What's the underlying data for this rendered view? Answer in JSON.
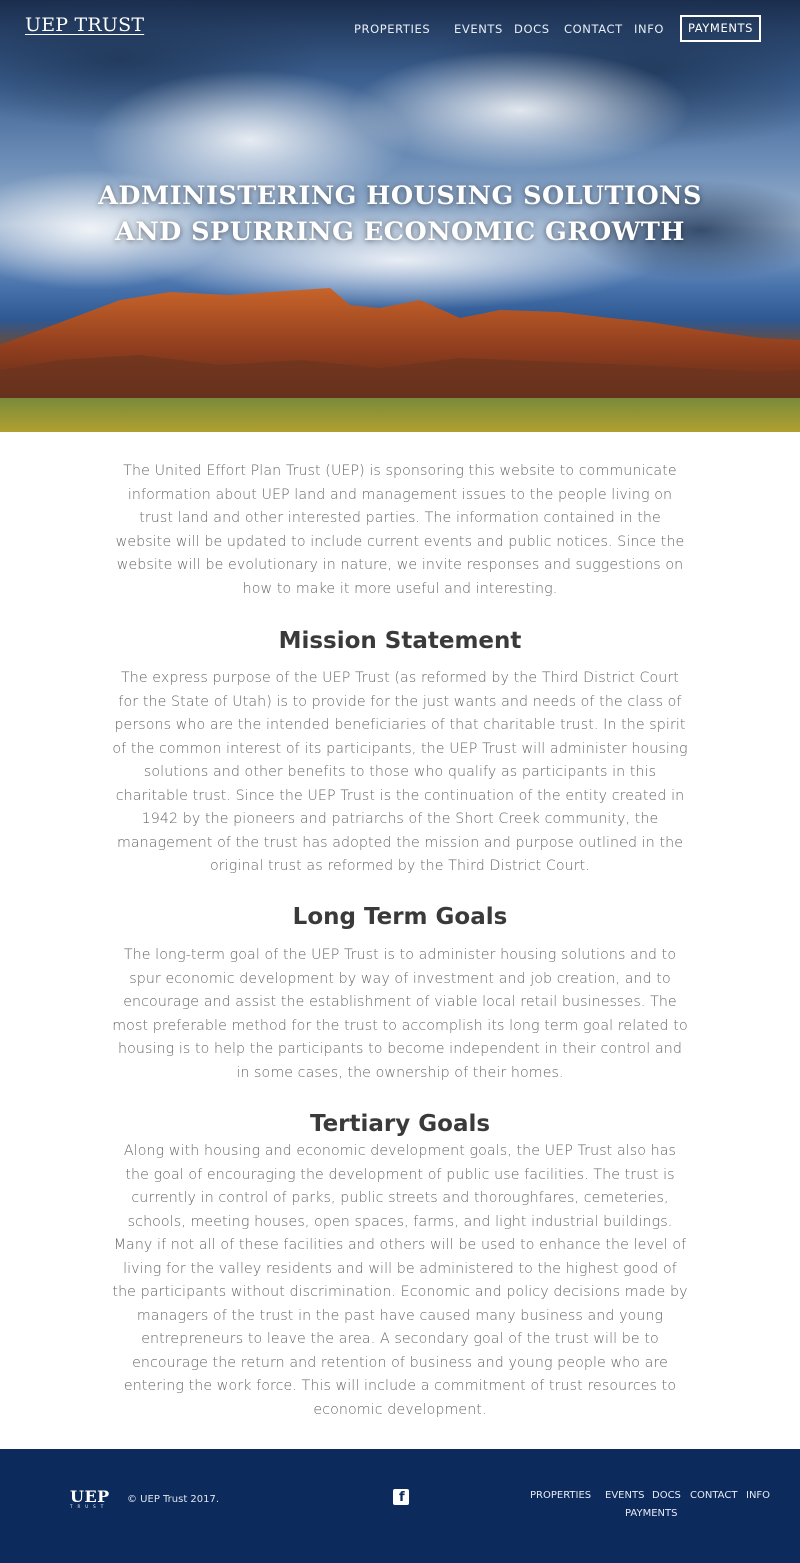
{
  "header": {
    "brand": "UEP TRUST",
    "nav": [
      "PROPERTIES",
      "EVENTS",
      "DOCS",
      "CONTACT",
      "INFO"
    ],
    "payments_button": "PAYMENTS"
  },
  "hero": {
    "title_line1": "ADMINISTERING HOUSING SOLUTIONS",
    "title_line2": "AND SPURRING ECONOMIC GROWTH"
  },
  "main": {
    "intro": "The United Effort Plan Trust (UEP) is sponsoring this website to communicate information about UEP land and management issues to the people living on trust land and other interested parties. The information contained in the website will be updated to include current events and public notices. Since the website will be evolutionary in nature, we invite responses and suggestions on how to make it more useful and interesting.",
    "sections": [
      {
        "heading": "Mission Statement",
        "body": "The express purpose of the UEP Trust (as reformed by the Third District Court for the State of Utah) is to provide for the just wants and needs of the class of persons who are the intended beneficiaries of that charitable trust. In the spirit of the common interest of its participants, the UEP Trust will administer housing solutions and other benefits to those who qualify as participants in this charitable trust. Since the UEP Trust is the continuation of the entity created in 1942 by the pioneers and patriarchs of the Short Creek community, the management of the trust has adopted the mission and purpose outlined in the original trust as reformed by the Third District Court."
      },
      {
        "heading": "Long Term Goals",
        "body": "The long-term goal of the UEP Trust is to administer housing solutions and to spur economic development by way of investment and job creation, and to encourage and assist the establishment of viable local retail businesses. The most preferable method for the trust to accomplish its long term goal related to housing is to help the participants to become independent in their control and in some cases, the ownership of their homes."
      },
      {
        "heading": "Tertiary Goals",
        "body": "Along with housing and economic development goals, the UEP Trust also has the goal of encouraging the development of public use facilities. The trust is currently in control of parks, public streets and thoroughfares, cemeteries, schools, meeting houses, open spaces, farms, and light industrial buildings. Many if not all of these facilities and others will be used to enhance the level of living for the valley residents and will be administered to the highest good of the participants without discrimination. Economic and policy decisions made by managers of the trust in the past have caused many business and young entrepreneurs to leave the area. A secondary goal of the trust will be to encourage the return and retention of business and young people who are entering the work force. This will include a commitment of trust resources to economic development."
      }
    ]
  },
  "footer": {
    "logo_text": "UEP",
    "logo_subtext": "TRUST",
    "copyright": "© UEP Trust 2017.",
    "social_icon": "facebook-icon",
    "nav": [
      "PROPERTIES",
      "EVENTS",
      "DOCS",
      "CONTACT",
      "INFO",
      "PAYMENTS"
    ],
    "background_color": "#0d2a5c"
  }
}
